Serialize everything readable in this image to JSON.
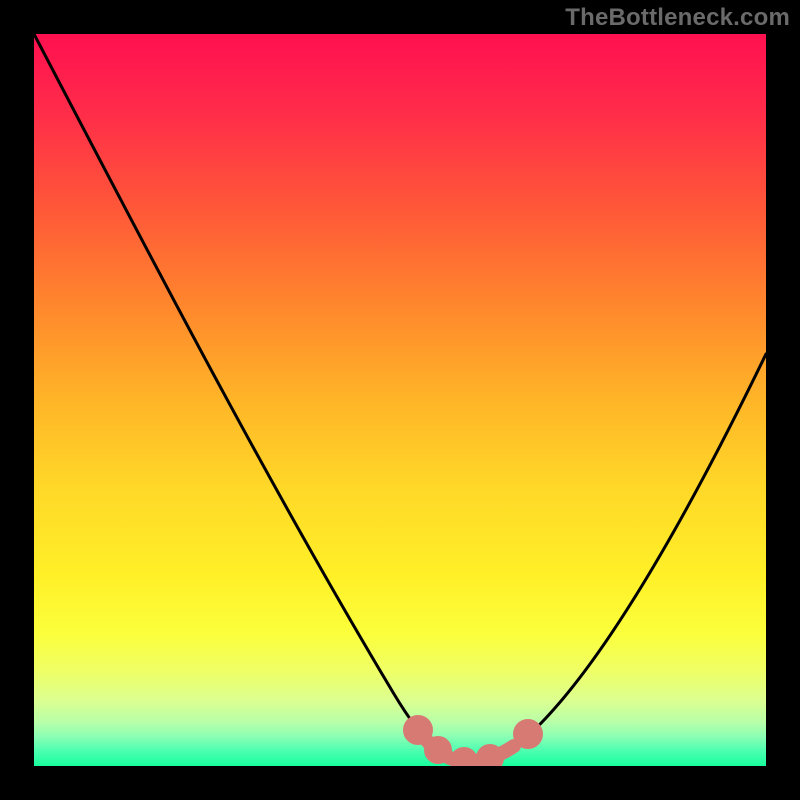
{
  "watermark": "TheBottleneck.com",
  "chart_data": {
    "type": "line",
    "title": "",
    "xlabel": "",
    "ylabel": "",
    "xlim": [
      0,
      100
    ],
    "ylim": [
      0,
      100
    ],
    "series": [
      {
        "name": "bottleneck-curve",
        "x": [
          0,
          4,
          8,
          12,
          16,
          20,
          24,
          28,
          32,
          36,
          40,
          44,
          48,
          52,
          55,
          57,
          59,
          61,
          63,
          65,
          68,
          72,
          76,
          80,
          84,
          88,
          92,
          96,
          100
        ],
        "y": [
          100,
          93,
          86,
          79,
          72,
          65,
          58,
          51,
          44,
          37,
          30,
          23,
          17,
          11,
          6,
          4,
          2,
          1,
          1,
          2,
          4,
          9,
          15,
          22,
          29,
          36,
          43,
          50,
          57
        ]
      }
    ],
    "highlight": {
      "color": "#d87a74",
      "x": [
        55,
        57,
        59,
        61,
        63,
        65,
        68
      ],
      "y": [
        6,
        4,
        2,
        1,
        1,
        2,
        4
      ]
    },
    "gradient_stops": [
      {
        "pos": 0,
        "color": "#ff1050"
      },
      {
        "pos": 50,
        "color": "#ffd828"
      },
      {
        "pos": 100,
        "color": "#18ff9e"
      }
    ]
  }
}
